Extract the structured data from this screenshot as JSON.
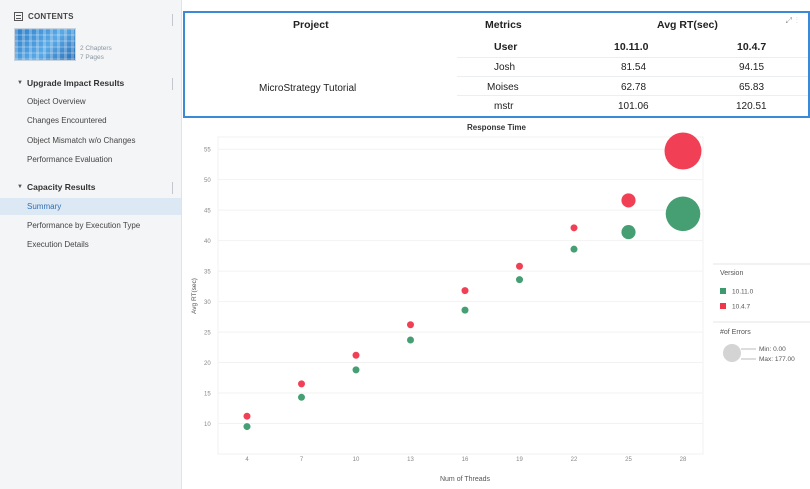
{
  "sidebar": {
    "contents_label": "CONTENTS",
    "thumbnail_meta": {
      "chapters": "2 Chapters",
      "pages": "7 Pages"
    },
    "sections": [
      {
        "title": "Upgrade Impact Results",
        "items": [
          {
            "label": "Object Overview"
          },
          {
            "label": "Changes Encountered"
          },
          {
            "label": "Object Mismatch w/o Changes"
          },
          {
            "label": "Performance Evaluation"
          }
        ]
      },
      {
        "title": "Capacity Results",
        "items": [
          {
            "label": "Summary",
            "active": true
          },
          {
            "label": "Performance by Execution Type"
          },
          {
            "label": "Execution Details"
          }
        ]
      }
    ]
  },
  "table": {
    "headers": {
      "project": "Project",
      "metrics": "Metrics",
      "avg_rt": "Avg RT(sec)"
    },
    "subheaders": {
      "user": "User",
      "v1": "10.11.0",
      "v2": "10.4.7"
    },
    "project_name": "MicroStrategy Tutorial",
    "rows": [
      {
        "user": "Josh",
        "v1": "81.54",
        "v2": "94.15"
      },
      {
        "user": "Moises",
        "v1": "62.78",
        "v2": "65.83"
      },
      {
        "user": "mstr",
        "v1": "101.06",
        "v2": "120.51"
      }
    ]
  },
  "chart_data": {
    "type": "scatter",
    "title": "Response Time",
    "xlabel": "Num of Threads",
    "ylabel": "Avg RT(sec)",
    "x_ticks": [
      "4",
      "7",
      "10",
      "13",
      "16",
      "19",
      "22",
      "25",
      "28"
    ],
    "y_ticks": [
      "10",
      "15",
      "20",
      "25",
      "30",
      "35",
      "40",
      "45",
      "50",
      "55"
    ],
    "ylim": [
      5,
      57
    ],
    "legend": {
      "version_title": "Version",
      "items": [
        {
          "label": "10.11.0",
          "color": "#3c9a6c"
        },
        {
          "label": "10.4.7",
          "color": "#f0364c"
        }
      ],
      "size_title": "#of Errors",
      "size_min": "Min: 0.00",
      "size_max": "Max: 177.00"
    },
    "series": [
      {
        "name": "10.11.0",
        "color": "#3c9a6c",
        "x": [
          4,
          7,
          10,
          13,
          16,
          19,
          22,
          25,
          28
        ],
        "y": [
          9.5,
          14.3,
          18.8,
          23.7,
          28.6,
          33.6,
          38.6,
          41.4,
          44.4
        ],
        "errors": [
          0,
          0,
          0,
          0,
          0,
          0,
          0,
          10,
          150
        ]
      },
      {
        "name": "10.4.7",
        "color": "#f0364c",
        "x": [
          4,
          7,
          10,
          13,
          16,
          19,
          22,
          25,
          28
        ],
        "y": [
          11.2,
          16.5,
          21.2,
          26.2,
          31.8,
          35.8,
          42.1,
          46.6,
          54.7
        ],
        "errors": [
          0,
          0,
          0,
          0,
          0,
          0,
          0,
          10,
          177
        ]
      }
    ]
  }
}
